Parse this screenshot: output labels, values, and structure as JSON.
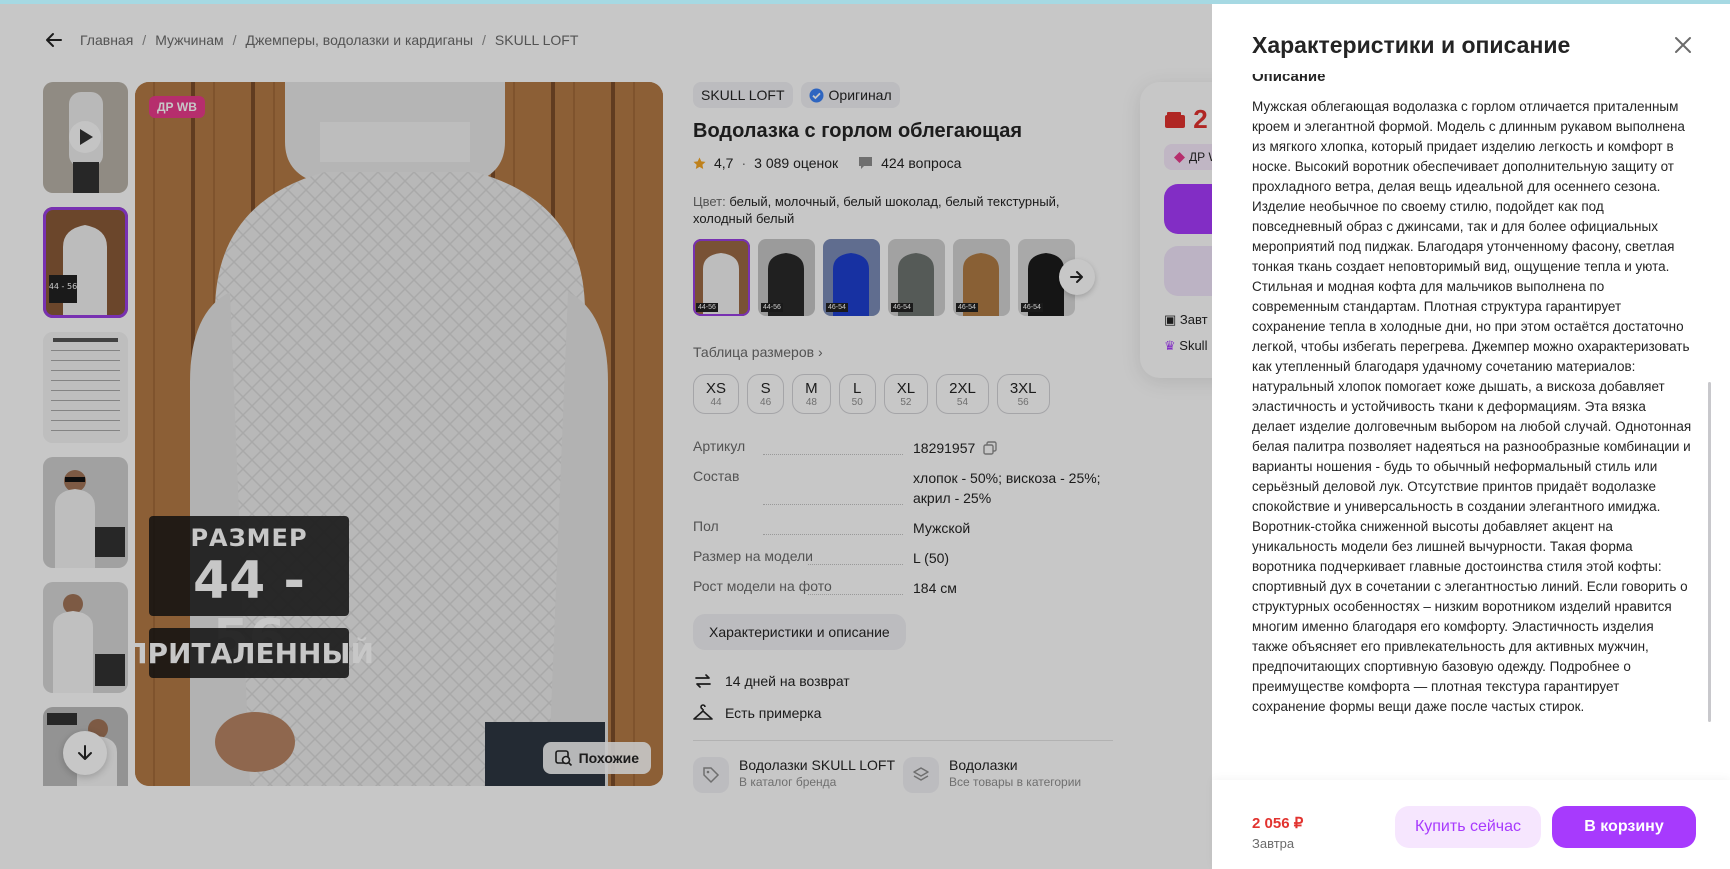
{
  "breadcrumbs": [
    "Главная",
    "Мужчинам",
    "Джемперы, водолазки и кардиганы",
    "SKULL LOFT"
  ],
  "photo": {
    "badge": "ДР WB",
    "size_label": "РАЗМЕР",
    "size_value": "44 - 56",
    "fit_label": "ПРИТАЛЕННЫЙ",
    "similar_label": "Похожие"
  },
  "product": {
    "brand": "SKULL LOFT",
    "original_label": "Оригинал",
    "title": "Водолазка с горлом облегающая",
    "rating": "4,7",
    "reviews": "3 089 оценок",
    "questions": "424 вопроса",
    "color_label": "Цвет:",
    "colors": "белый, молочный, белый шоколад, белый текстурный, холодный белый",
    "size_table_label": "Таблица размеров",
    "sizes": [
      {
        "name": "XS",
        "num": "44"
      },
      {
        "name": "S",
        "num": "46"
      },
      {
        "name": "M",
        "num": "48"
      },
      {
        "name": "L",
        "num": "50"
      },
      {
        "name": "XL",
        "num": "52"
      },
      {
        "name": "2XL",
        "num": "54"
      },
      {
        "name": "3XL",
        "num": "56"
      }
    ],
    "specs": [
      {
        "k": "Артикул",
        "v": "18291957"
      },
      {
        "k": "Состав",
        "v": "хлопок - 50%; вискоза - 25%; акрил - 25%"
      },
      {
        "k": "Пол",
        "v": "Мужской"
      },
      {
        "k": "Размер на модели",
        "v": "L (50)"
      },
      {
        "k": "Рост модели на фото",
        "v": "184 см"
      }
    ],
    "desc_button": "Характеристики и описание",
    "perks": [
      "14 дней на возврат",
      "Есть примерка"
    ],
    "links": [
      {
        "t": "Водолазки SKULL LOFT",
        "s": "В каталог бренда"
      },
      {
        "t": "Водолазки",
        "s": "Все товары в категории"
      }
    ]
  },
  "swatch_labels": [
    "44-56",
    "44-56",
    "46-54",
    "46-54",
    "46-54",
    "46-54"
  ],
  "buybox": {
    "price_partial": "2",
    "pill_partial": "ДР W",
    "row1_partial": "Завт",
    "row2_partial": "Skull"
  },
  "panel": {
    "title": "Характеристики и описание",
    "subtitle": "Описание",
    "text": "Мужская облегающая водолазка с горлом отличается приталенным кроем и элегантной формой. Модель с длинным рукавом выполнена из мягкого хлопка, который придает изделию легкость и комфорт в носке. Высокий воротник обеспечивает дополнительную защиту от прохладного ветра, делая вещь идеальной для осеннего сезона. Изделие необычное по своему стилю, подойдет как под повседневный образ с джинсами, так и для более официальных мероприятий под пиджак. Благодаря утонченному фасону, светлая тонкая ткань создает неповторимый вид, ощущение тепла и уюта. Стильная и модная кофта для мальчиков выполнена по современным стандартам. Плотная структура гарантирует сохранение тепла в холодные дни, но при этом остаётся достаточно легкой, чтобы избегать перегрева. Джемпер можно охарактеризовать как утепленный благодаря удачному сочетанию материалов: натуральный хлопок помогает коже дышать, а вискоза добавляет эластичность и устойчивость ткани к деформациям. Эта вязка делает изделие долговечным выбором на любой случай. Однотонная белая палитра позволяет надеяться на разнообразные комбинации и варианты ношения - будь то обычный неформальный стиль или серьёзный деловой лук. Отсутствие принтов придаёт водолазке спокойствие и универсальность в создании элегантного имиджа. Воротник-стойка сниженной высоты добавляет акцент на уникальность модели без лишней вычурности. Такая форма воротника подчеркивает главные достоинства стиля этой кофты: спортивный дух в сочетании с элегантностью линий. Если говорить о структурных особенностях – низким воротником изделий нравится многим именно благодаря его комфорту. Эластичность изделия также объясняет его привлекательность для активных мужчин, предпочитающих спортивную базовую одежду. Подробнее о преимуществе комфорта — плотная текстура гарантирует сохранение формы вещи даже после частых стирок.",
    "price": "2 056 ₽",
    "delivery": "Завтра",
    "buy_now": "Купить сейчас",
    "to_cart": "В корзину"
  },
  "colors": {
    "accent": "#a73afd",
    "price_red": "#e2332f",
    "badge_pink": "#e93b8c"
  }
}
